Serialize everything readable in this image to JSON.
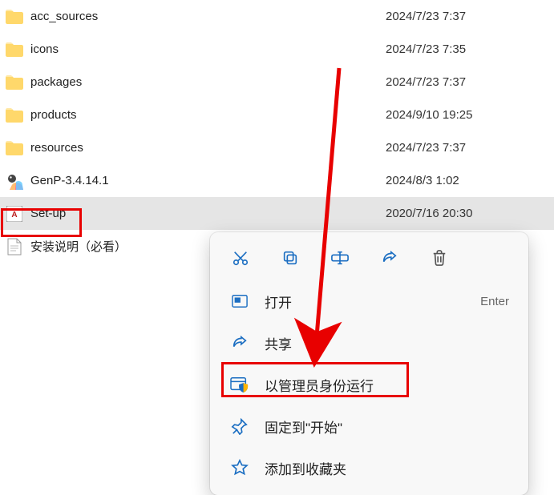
{
  "files": [
    {
      "name": "acc_sources",
      "date": "2024/7/23 7:37",
      "type": "folder"
    },
    {
      "name": "icons",
      "date": "2024/7/23 7:35",
      "type": "folder"
    },
    {
      "name": "packages",
      "date": "2024/7/23 7:37",
      "type": "folder"
    },
    {
      "name": "products",
      "date": "2024/9/10 19:25",
      "type": "folder"
    },
    {
      "name": "resources",
      "date": "2024/7/23 7:37",
      "type": "folder"
    },
    {
      "name": "GenP-3.4.14.1",
      "date": "2024/8/3 1:02",
      "type": "genp"
    },
    {
      "name": "Set-up",
      "date": "2020/7/16 20:30",
      "type": "adobe",
      "selected": true
    },
    {
      "name": "安装说明（必看）",
      "date": "",
      "type": "text"
    }
  ],
  "menu": {
    "open": {
      "label": "打开",
      "shortcut": "Enter"
    },
    "share": {
      "label": "共享"
    },
    "admin": {
      "label": "以管理员身份运行"
    },
    "pin": {
      "label": "固定到\"开始\""
    },
    "fav": {
      "label": "添加到收藏夹"
    }
  }
}
